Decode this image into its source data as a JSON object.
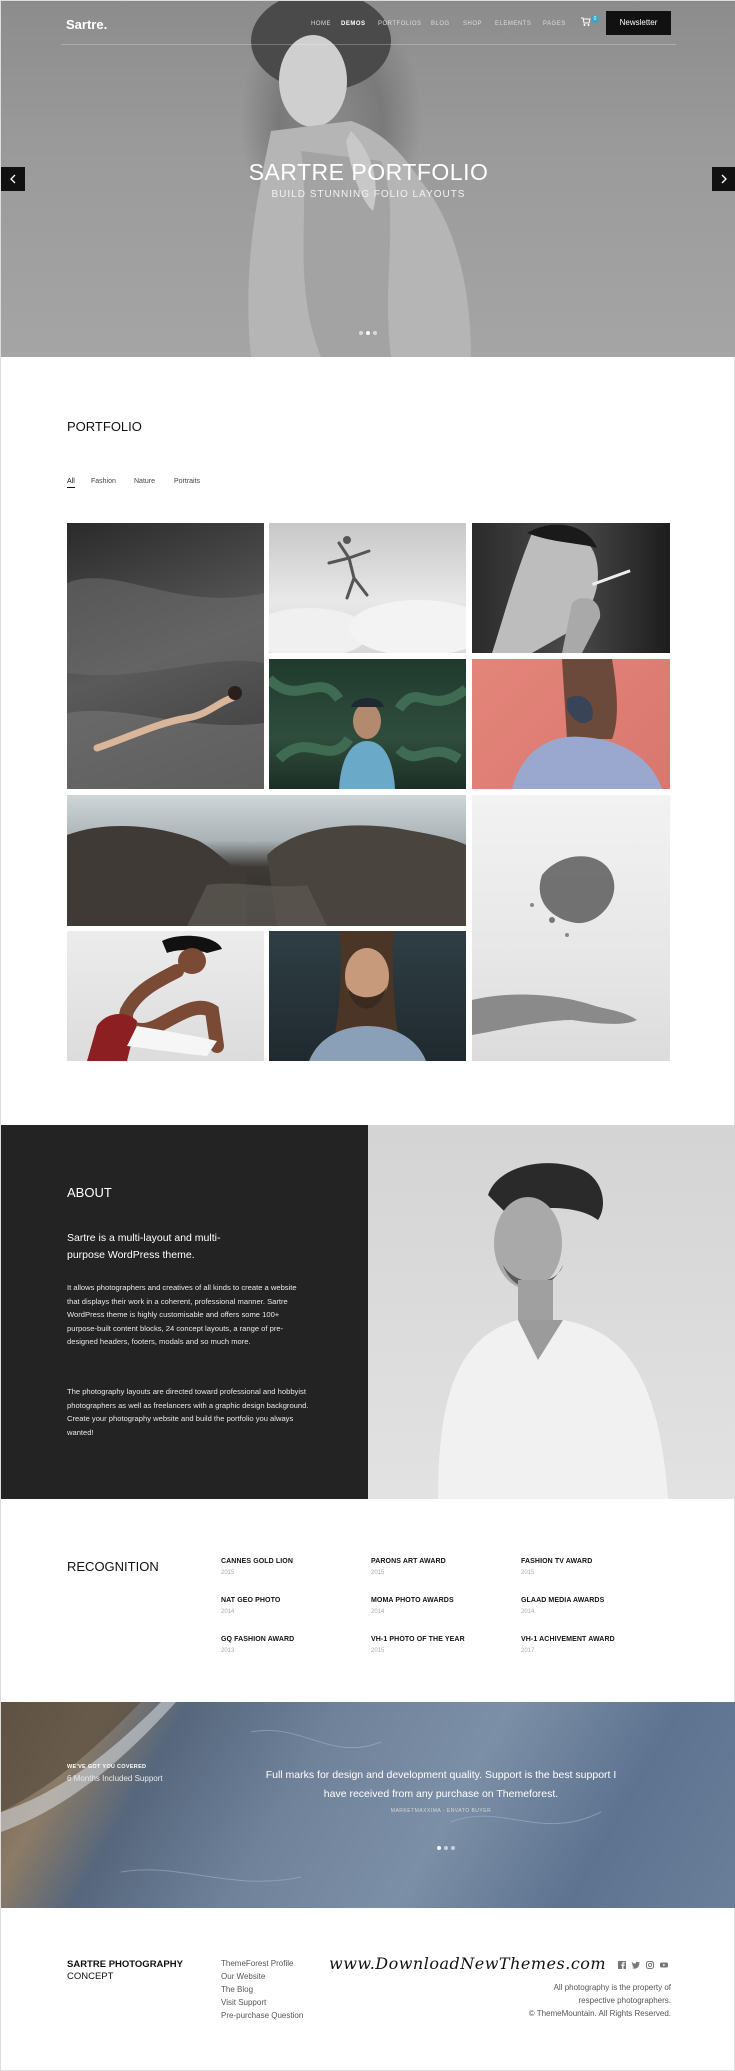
{
  "nav": {
    "logo": "Sartre.",
    "links": [
      "HOME",
      "DEMOS",
      "PORTFOLIOS",
      "BLOG",
      "SHOP",
      "ELEMENTS",
      "PAGES"
    ],
    "cart_count": "0",
    "newsletter_label": "Newsletter"
  },
  "hero": {
    "title": "SARTRE PORTFOLIO",
    "subtitle": "BUILD STUNNING FOLIO LAYOUTS",
    "prev_icon": "chevron-left-icon",
    "next_icon": "chevron-right-icon",
    "slide_count": 3,
    "active_slide": 2
  },
  "portfolio": {
    "title": "PORTFOLIO",
    "filters": [
      "All",
      "Fashion",
      "Nature",
      "Portraits"
    ],
    "active_filter": "All"
  },
  "about": {
    "title": "ABOUT",
    "lead": "Sartre is a multi-layout and multi-purpose WordPress theme.",
    "p1": "It allows photographers and creatives of all kinds to create a website that displays their work in a coherent, professional manner. Sartre WordPress theme is highly customisable and offers some 100+ purpose-built content blocks, 24 concept layouts, a range of pre-designed headers, footers, modals and so much more.",
    "p2": "The photography layouts are directed toward professional and hobbyist photographers as well as freelancers with a graphic design background. Create your photography website and build the portfolio you always wanted!"
  },
  "recognition": {
    "title": "RECOGNITION",
    "awards": [
      {
        "name": "CANNES GOLD LION",
        "year": "2015"
      },
      {
        "name": "PARONS ART AWARD",
        "year": "2015"
      },
      {
        "name": "FASHION TV AWARD",
        "year": "2015"
      },
      {
        "name": "NAT GEO PHOTO",
        "year": "2014"
      },
      {
        "name": "MOMA PHOTO AWARDS",
        "year": "2014"
      },
      {
        "name": "GLAAD MEDIA AWARDS",
        "year": "2014"
      },
      {
        "name": "GQ FASHION AWARD",
        "year": "2013"
      },
      {
        "name": "VH-1 PHOTO OF THE YEAR",
        "year": "2015"
      },
      {
        "name": "VH-1 ACHIVEMENT AWARD",
        "year": "2017"
      }
    ]
  },
  "testimonial": {
    "label1": "WE'VE GOT YOU COVERED",
    "label2": "6 Months Included Support",
    "quote": "Full marks for design and development quality. Support is the best support I have received from any purchase on Themeforest.",
    "author": "MARKETMAXXIMA - ENVATO BUYER",
    "slide_count": 3,
    "active_slide": 1
  },
  "footer": {
    "brand_line1": "SARTRE PHOTOGRAPHY",
    "brand_line2": "CONCEPT",
    "links": [
      "ThemeForest Profile",
      "Our Website",
      "The Blog",
      "Visit Support",
      "Pre-purchase Question"
    ],
    "watermark": "www.DownloadNewThemes.com",
    "social_icons": [
      "facebook-icon",
      "twitter-icon",
      "instagram-icon",
      "youtube-icon"
    ],
    "copy1": "All photography is the property of",
    "copy2": "respective photographers.",
    "copy3": "© ThemeMountain. All Rights Reserved."
  },
  "colors": {
    "accent": "#39a4c4",
    "dark": "#232323",
    "black_button": "#111111"
  }
}
